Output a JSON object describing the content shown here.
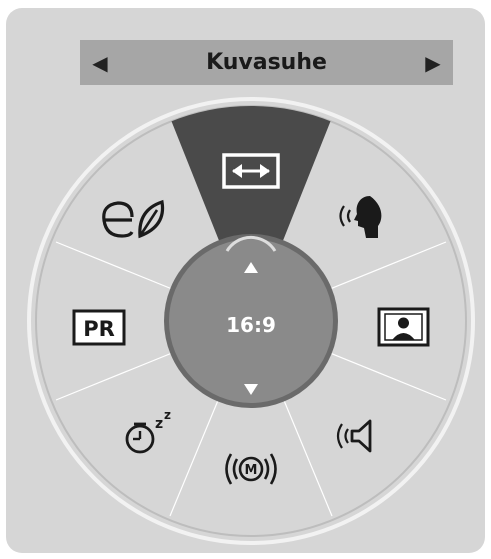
{
  "header": {
    "title": "Kuvasuhe",
    "prev_icon": "left-triangle",
    "next_icon": "right-triangle"
  },
  "dial": {
    "selected_item": "aspect-ratio",
    "center_value": "16:9",
    "items": [
      {
        "id": "aspect-ratio",
        "icon": "aspect-ratio-icon"
      },
      {
        "id": "voice",
        "icon": "voice-icon"
      },
      {
        "id": "picture-mode",
        "icon": "picture-icon"
      },
      {
        "id": "sound-mode",
        "icon": "speaker-icon"
      },
      {
        "id": "multi-audio",
        "icon": "m-audio-icon"
      },
      {
        "id": "sleep-timer",
        "icon": "sleep-timer-icon"
      },
      {
        "id": "program-list",
        "icon": "pr-icon"
      },
      {
        "id": "energy-saving",
        "icon": "eco-leaf-icon"
      }
    ]
  },
  "colors": {
    "panel": "#d6d6d6",
    "title_bar": "#a6a6a6",
    "selected_wedge": "#4a4a4a",
    "center": "#8a8a8a",
    "icon": "#1a1a1a"
  }
}
